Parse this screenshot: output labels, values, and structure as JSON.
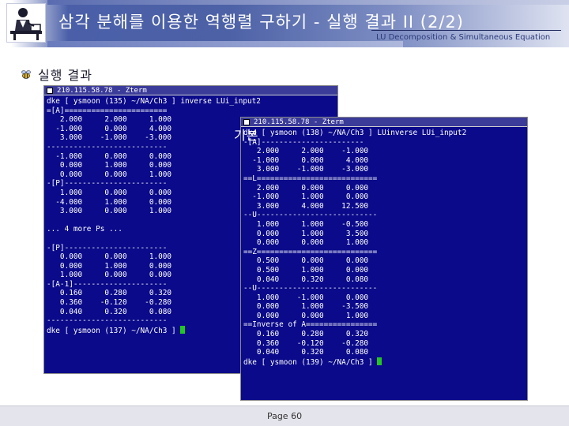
{
  "header": {
    "title": "삼각 분해를 이용한 역행렬 구하기 - 실행 결과 II (2/2)",
    "subtitle": "LU Decomposition & Simultaneous Equation"
  },
  "bullet": {
    "text": "실행 결과"
  },
  "overlay_label": "기본",
  "terminal_left": {
    "title": "210.115.58.78 - Zterm",
    "lines": [
      "dke [ ysmoon (135) ~/NA/Ch3 ] inverse LUi_input2",
      "=[A]=======================",
      "   2.000     2.000     1.000",
      "  -1.000     0.000     4.000",
      "   3.000    -1.000    -3.000",
      "---------------------------",
      "  -1.000     0.000     0.000",
      "   0.000     1.000     0.000",
      "   0.000     0.000     1.000",
      "-[P]-----------------------",
      "   1.000     0.000     0.000",
      "  -4.000     1.000     0.000",
      "   3.000     0.000     1.000",
      "",
      "... 4 more Ps ...",
      "",
      "-[P]-----------------------",
      "   0.000     0.000     1.000",
      "   0.000     1.000     0.000",
      "   1.000     0.000     0.000",
      "-[A-1]---------------------",
      "   0.160     0.280     0.320",
      "   0.360    -0.120    -0.280",
      "   0.040     0.320     0.080",
      "---------------------------",
      "dke [ ysmoon (137) ~/NA/Ch3 ] "
    ]
  },
  "terminal_right": {
    "title": "210.115.58.78 - Zterm",
    "lines": [
      "dke [ ysmoon (138) ~/NA/Ch3 ] LUinverse LUi_input2",
      "-[A]-----------------------",
      "   2.000     2.000    -1.000",
      "  -1.000     0.000     4.000",
      "   3.000    -1.000    -3.000",
      "==L===========================",
      "   2.000     0.000     0.000",
      "  -1.000     1.000     0.000",
      "   3.000     4.000    12.500",
      "--U---------------------------",
      "   1.000     1.000    -0.500",
      "   0.000     1.000     3.500",
      "   0.000     0.000     1.000",
      "==Z===========================",
      "   0.500     0.000     0.000",
      "   0.500     1.000     0.000",
      "   0.040     0.320     0.080",
      "--U---------------------------",
      "   1.000    -1.000     0.000",
      "   0.000     1.000    -3.500",
      "   0.000     0.000     1.000",
      "==Inverse of A================",
      "   0.160     0.280     0.320",
      "   0.360    -0.120    -0.280",
      "   0.040     0.320     0.080",
      "dke [ ysmoon (139) ~/NA/Ch3 ] "
    ]
  },
  "footer": {
    "page": "Page 60"
  },
  "colors": {
    "terminal_bg": "#0a0a8a",
    "cursor": "#22c822",
    "header_blue": "#4a5fa8"
  },
  "icons": {
    "logo": "person-at-desk-icon",
    "bullet": "bee-icon"
  }
}
